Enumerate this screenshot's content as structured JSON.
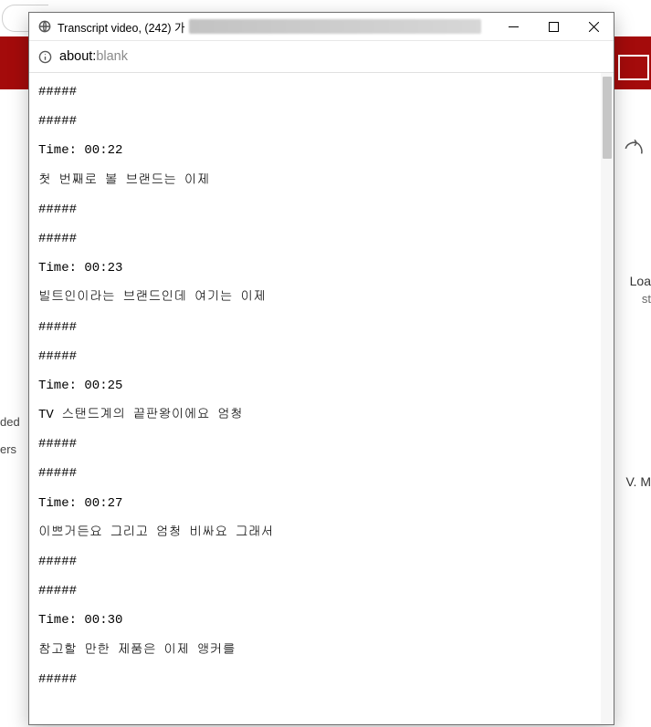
{
  "window": {
    "title": "Transcript video, (242) 가",
    "url_prefix": "about:",
    "url_suffix": "blank"
  },
  "bg": {
    "side1": "ded",
    "side2": "ers ",
    "loa": "Loa",
    "st": "st",
    "vm": "V. M"
  },
  "transcript": [
    {
      "sep_open": "#####",
      "sep_close": "#####"
    },
    {
      "sep_open": "#####",
      "time": "Time: 00:22",
      "text": "첫 번째로 볼 브랜드는 이제",
      "sep_close": "#####"
    },
    {
      "sep_open": "#####",
      "time": "Time: 00:23",
      "text": "빌트인이라는 브랜드인데 여기는 이제",
      "sep_close": "#####"
    },
    {
      "sep_open": "#####",
      "time": "Time: 00:25",
      "text": "TV 스탠드계의 끝판왕이에요 엄청",
      "sep_close": "#####"
    },
    {
      "sep_open": "#####",
      "time": "Time: 00:27",
      "text": "이쁘거든요 그리고 엄청 비싸요 그래서",
      "sep_close": "#####"
    },
    {
      "sep_open": "#####",
      "time": "Time: 00:30",
      "text": "참고할 만한 제품은 이제 앵커를",
      "sep_close": "#####"
    }
  ]
}
